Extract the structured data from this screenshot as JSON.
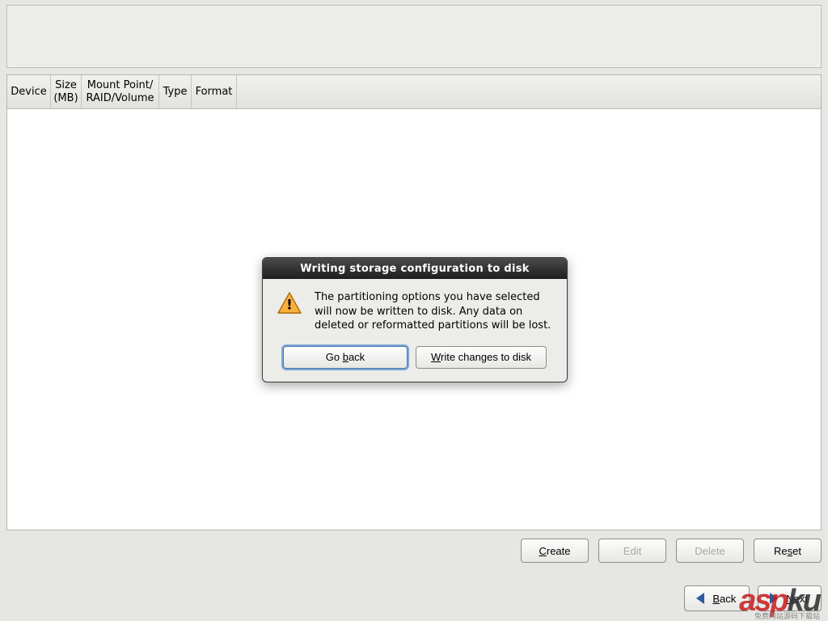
{
  "table": {
    "headers": {
      "device": "Device",
      "size": "Size\n(MB)",
      "mount": "Mount Point/\nRAID/Volume",
      "type": "Type",
      "format": "Format"
    },
    "rows": []
  },
  "actions": {
    "create": "Create",
    "edit": "Edit",
    "delete": "Delete",
    "reset": "Reset",
    "edit_enabled": false,
    "delete_enabled": false
  },
  "nav": {
    "back": "Back",
    "next": "Next"
  },
  "dialog": {
    "title": "Writing storage configuration to disk",
    "message": "The partitioning options you have selected will now be written to disk.  Any data on deleted or reformatted partitions will be lost.",
    "go_back": "Go back",
    "write": "Write changes to disk"
  },
  "watermark": {
    "text_red": "asp",
    "text_dark": "ku",
    "sub": "免费网站源码下载站"
  }
}
